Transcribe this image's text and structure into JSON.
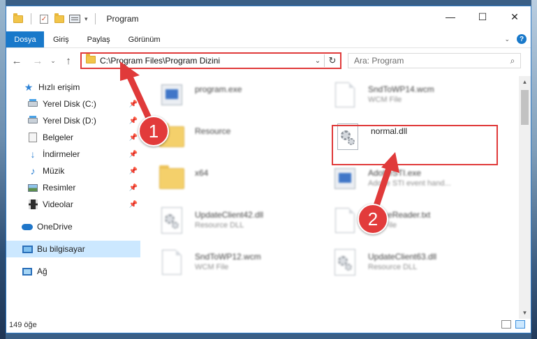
{
  "window": {
    "title": "Program",
    "buttons": {
      "minimize": "—",
      "maximize": "☐",
      "close": "✕"
    }
  },
  "ribbon": {
    "file_tab": "Dosya",
    "tabs": [
      "Giriş",
      "Paylaş",
      "Görünüm"
    ],
    "help": "?"
  },
  "address": {
    "path": "C:\\Program Files\\Program Dizini",
    "search_placeholder": "Ara: Program"
  },
  "sidebar": {
    "items": [
      {
        "label": "Hızlı erişim",
        "icon": "star-icon"
      },
      {
        "label": "Yerel Disk (C:)",
        "icon": "disk-icon",
        "pinned": true
      },
      {
        "label": "Yerel Disk (D:)",
        "icon": "disk-icon",
        "pinned": true
      },
      {
        "label": "Belgeler",
        "icon": "documents-icon",
        "pinned": true
      },
      {
        "label": "İndirmeler",
        "icon": "downloads-icon",
        "pinned": true
      },
      {
        "label": "Müzik",
        "icon": "music-icon",
        "pinned": true
      },
      {
        "label": "Resimler",
        "icon": "pictures-icon",
        "pinned": true
      },
      {
        "label": "Videolar",
        "icon": "videos-icon",
        "pinned": true
      },
      {
        "label": "OneDrive",
        "icon": "onedrive-icon"
      },
      {
        "label": "Bu bilgisayar",
        "icon": "this-pc-icon",
        "selected": true
      },
      {
        "label": "Ağ",
        "icon": "network-icon"
      }
    ]
  },
  "files": [
    {
      "name": "program.exe",
      "sub": "",
      "icon": "exe-icon"
    },
    {
      "name": "SndToWP14.wcm",
      "sub": "WCM File",
      "icon": "file-icon"
    },
    {
      "name": "Resource",
      "sub": "",
      "icon": "folder-icon"
    },
    {
      "name": "normal.dll",
      "sub": "",
      "icon": "dll-gear-icon",
      "highlighted": true
    },
    {
      "name": "x64",
      "sub": "",
      "icon": "folder-icon"
    },
    {
      "name": "AdobeSTI.exe",
      "sub": "Adobe STI event hand...",
      "icon": "exe-icon"
    },
    {
      "name": "UpdateClient42.dll",
      "sub": "Resource DLL",
      "icon": "dll-gear-icon"
    },
    {
      "name": "OnlineReader.txt",
      "sub": "Text File",
      "icon": "file-icon"
    },
    {
      "name": "SndToWP12.wcm",
      "sub": "WCM File",
      "icon": "file-icon"
    },
    {
      "name": "UpdateClient63.dll",
      "sub": "Resource DLL",
      "icon": "dll-gear-icon"
    }
  ],
  "status": {
    "count": "149 öğe"
  },
  "callouts": {
    "first": "1",
    "second": "2"
  },
  "colors": {
    "accent": "#1979ca",
    "highlight": "#e03a3a",
    "selection": "#cce8ff"
  }
}
